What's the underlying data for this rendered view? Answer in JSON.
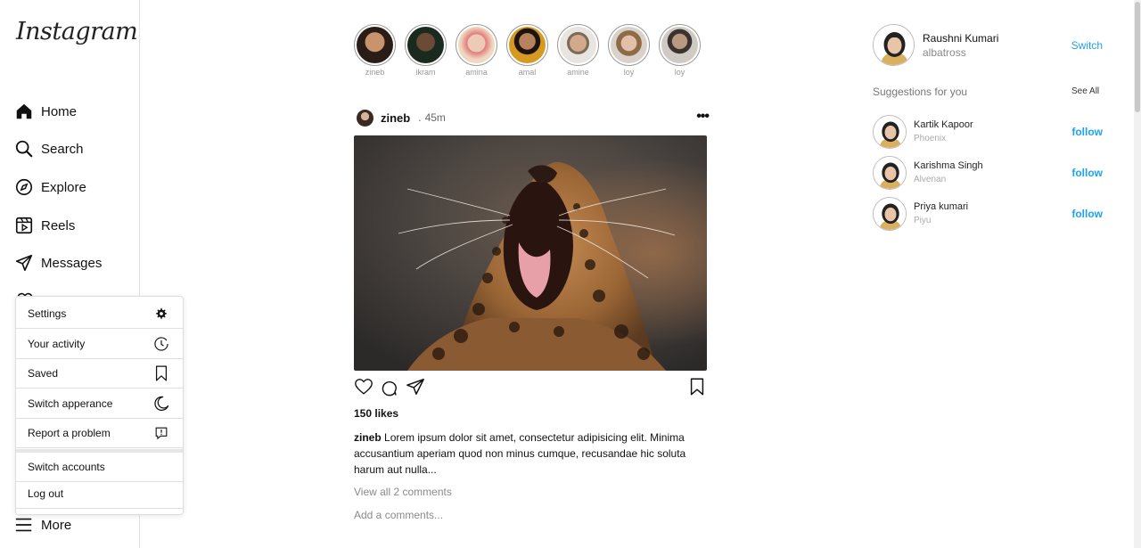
{
  "app": {
    "logo": "Instagram"
  },
  "sidebar": {
    "items": [
      {
        "label": "Home",
        "icon": "home-icon"
      },
      {
        "label": "Search",
        "icon": "search-icon"
      },
      {
        "label": "Explore",
        "icon": "compass-icon"
      },
      {
        "label": "Reels",
        "icon": "reels-icon"
      },
      {
        "label": "Messages",
        "icon": "send-icon"
      }
    ],
    "more_label": "More"
  },
  "menu": {
    "items": [
      {
        "label": "Settings",
        "icon": "gear-icon"
      },
      {
        "label": "Your activity",
        "icon": "clock-icon"
      },
      {
        "label": "Saved",
        "icon": "bookmark-icon"
      },
      {
        "label": "Switch apperance",
        "icon": "moon-icon"
      },
      {
        "label": "Report a problem",
        "icon": "report-icon"
      }
    ],
    "switch_accounts": "Switch accounts",
    "logout": "Log out"
  },
  "stories": [
    {
      "name": "zineb",
      "color": "#c9946d"
    },
    {
      "name": "ikram",
      "color": "#3b4a3a"
    },
    {
      "name": "amina",
      "color": "#e9b7a8"
    },
    {
      "name": "amal",
      "color": "#d69a21"
    },
    {
      "name": "amine",
      "color": "#d9d4cd"
    },
    {
      "name": "loy",
      "color": "#b9a590"
    },
    {
      "name": "loy",
      "color": "#c7c2bd"
    }
  ],
  "post": {
    "user": "zineb",
    "time": "45m",
    "likes": "150 likes",
    "caption_user": "zineb",
    "caption_text": "Lorem ipsum dolor sit amet, consectetur adipisicing elit. Minima accusantium aperiam quod non minus cumque, recusandae hic soluta harum aut nulla...",
    "view_comments": "View all 2 comments",
    "add_comment": "Add a comments..."
  },
  "profile": {
    "name": "Raushni Kumari",
    "handle": "albatross",
    "switch_label": "Switch"
  },
  "suggestions": {
    "title": "Suggestions for you",
    "see_all": "See All",
    "items": [
      {
        "name": "Kartik Kapoor",
        "handle": "Phoenix",
        "action": "follow"
      },
      {
        "name": "Karishma Singh",
        "handle": "Alvenan",
        "action": "follow"
      },
      {
        "name": "Priya kumari",
        "handle": "Piyu",
        "action": "follow"
      }
    ]
  },
  "colors": {
    "link_blue": "#1da1f2"
  }
}
